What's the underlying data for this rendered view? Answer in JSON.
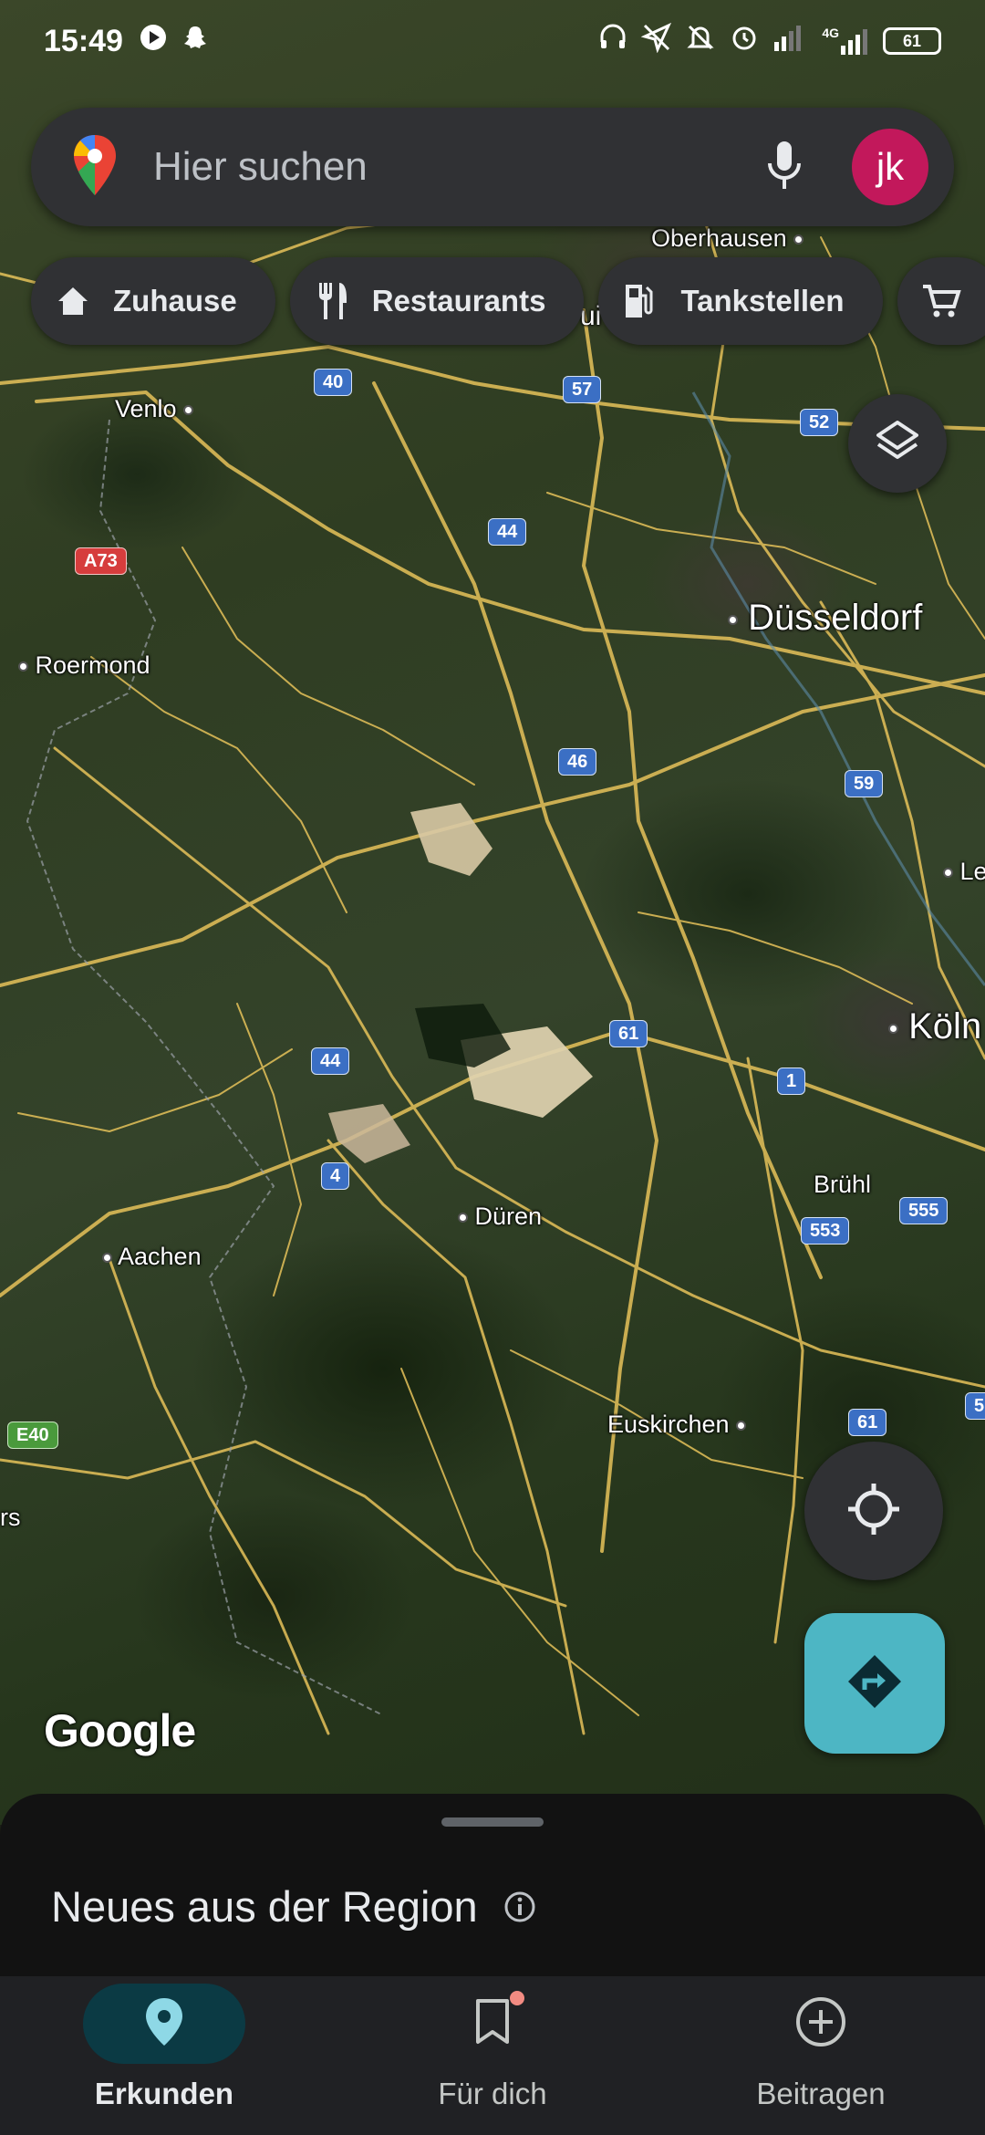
{
  "status_bar": {
    "time": "15:49",
    "network": "4G",
    "battery": "61"
  },
  "search": {
    "placeholder": "Hier suchen",
    "avatar_initials": "jk"
  },
  "chips": [
    {
      "label": "Zuhause",
      "icon": "home-icon"
    },
    {
      "label": "Restaurants",
      "icon": "restaurant-icon"
    },
    {
      "label": "Tankstellen",
      "icon": "gas-station-icon"
    },
    {
      "label": "",
      "icon": "shopping-cart-icon"
    }
  ],
  "map": {
    "cities": [
      {
        "name": "Oberhausen",
        "size": "small"
      },
      {
        "name": "Venlo",
        "size": "small"
      },
      {
        "name": "Roermond",
        "size": "small"
      },
      {
        "name": "Düsseldorf",
        "size": "large"
      },
      {
        "name": "Köln",
        "size": "large"
      },
      {
        "name": "Le",
        "size": "small"
      },
      {
        "name": "Brühl",
        "size": "small"
      },
      {
        "name": "Düren",
        "size": "small"
      },
      {
        "name": "Aachen",
        "size": "small"
      },
      {
        "name": "Euskirchen",
        "size": "small"
      },
      {
        "name": "rs",
        "size": "small"
      },
      {
        "name": "ui",
        "size": "small"
      }
    ],
    "road_shields": [
      "40",
      "57",
      "52",
      "44",
      "A73",
      "46",
      "59",
      "61",
      "44",
      "1",
      "4",
      "555",
      "553",
      "E40",
      "61",
      "5("
    ],
    "attribution": "Google"
  },
  "sheet": {
    "title": "Neues aus der Region"
  },
  "nav": [
    {
      "label": "Erkunden",
      "icon": "explore-pin-icon",
      "active": true
    },
    {
      "label": "Für dich",
      "icon": "bookmark-icon",
      "active": false
    },
    {
      "label": "Beitragen",
      "icon": "add-circle-icon",
      "active": false
    }
  ],
  "colors": {
    "avatar": "#c2185b",
    "directions_fab": "#4db6c4",
    "active_nav": "#0b3a44",
    "road_shield": "#3b6fc4",
    "roads": "#e6c25a"
  }
}
